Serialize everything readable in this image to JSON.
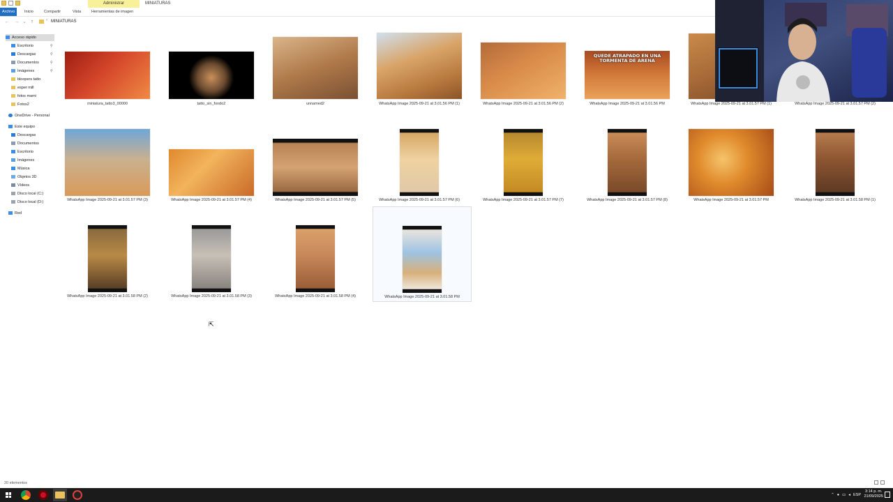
{
  "window": {
    "context_tab": "Administrar",
    "title": "MINIATURAS"
  },
  "ribbon": {
    "tabs": [
      {
        "label": "Archivo"
      },
      {
        "label": "Inicio"
      },
      {
        "label": "Compartir"
      },
      {
        "label": "Vista"
      },
      {
        "label": "Herramientas de imagen"
      }
    ]
  },
  "address": {
    "breadcrumb": "MINIATURAS"
  },
  "sidebar": {
    "items": [
      {
        "label": "Acceso rápido",
        "icon": "star-icon"
      },
      {
        "label": "Escritorio",
        "icon": "desktop-icon"
      },
      {
        "label": "Descargas",
        "icon": "download-icon"
      },
      {
        "label": "Documentos",
        "icon": "document-icon"
      },
      {
        "label": "Imágenes",
        "icon": "image-icon"
      },
      {
        "label": "bloopers tatto",
        "icon": "folder-icon"
      },
      {
        "label": "esper mill",
        "icon": "folder-icon"
      },
      {
        "label": "fotos mami",
        "icon": "folder-icon"
      },
      {
        "label": "Fotos2",
        "icon": "folder-icon"
      },
      {
        "label": "OneDrive - Personal",
        "icon": "cloud-icon"
      },
      {
        "label": "Este equipo",
        "icon": "computer-icon"
      },
      {
        "label": "Descargas",
        "icon": "download-icon"
      },
      {
        "label": "Documentos",
        "icon": "document-icon"
      },
      {
        "label": "Escritorio",
        "icon": "desktop-icon"
      },
      {
        "label": "Imágenes",
        "icon": "image-icon"
      },
      {
        "label": "Música",
        "icon": "music-icon"
      },
      {
        "label": "Objetos 3D",
        "icon": "cube-icon"
      },
      {
        "label": "Vídeos",
        "icon": "video-icon"
      },
      {
        "label": "Disco local (C:)",
        "icon": "drive-icon"
      },
      {
        "label": "Disco local (D:)",
        "icon": "drive-icon"
      },
      {
        "label": "Red",
        "icon": "network-icon"
      }
    ]
  },
  "files": [
    {
      "name": "miniatura_tatto3_00000"
    },
    {
      "name": "tatto_sin_fondo2"
    },
    {
      "name": "unnamed2"
    },
    {
      "name": "WhatsApp Image 2025-09-21 at 3.01.56 PM (1)"
    },
    {
      "name": "WhatsApp Image 2025-09-21 at 3.01.56 PM (2)"
    },
    {
      "name": "WhatsApp Image 2025-09-21 at 3.01.56 PM",
      "overlay": "QUEDE ATRAPADO EN UNA TORMENTA DE ARENA"
    },
    {
      "name": "WhatsApp Image 2025-09-21 at 3.01.57 PM (1)"
    },
    {
      "name": "WhatsApp Image 2025-09-21 at 3.01.57 PM (2)"
    },
    {
      "name": "WhatsApp Image 2025-09-21 at 3.01.57 PM (3)"
    },
    {
      "name": "WhatsApp Image 2025-09-21 at 3.01.57 PM (4)"
    },
    {
      "name": "WhatsApp Image 2025-09-21 at 3.01.57 PM (5)"
    },
    {
      "name": "WhatsApp Image 2025-09-21 at 3.01.57 PM (6)"
    },
    {
      "name": "WhatsApp Image 2025-09-21 at 3.01.57 PM (7)"
    },
    {
      "name": "WhatsApp Image 2025-09-21 at 3.01.57 PM (8)"
    },
    {
      "name": "WhatsApp Image 2025-09-21 at 3.01.57 PM"
    },
    {
      "name": "WhatsApp Image 2025-09-21 at 3.01.58 PM (1)"
    },
    {
      "name": "WhatsApp Image 2025-09-21 at 3.01.58 PM (2)"
    },
    {
      "name": "WhatsApp Image 2025-09-21 at 3.01.58 PM (3)"
    },
    {
      "name": "WhatsApp Image 2025-09-21 at 3.01.58 PM (4)"
    },
    {
      "name": "WhatsApp Image 2025-09-21 at 3.01.58 PM"
    }
  ],
  "status": {
    "count": "20 elementos"
  },
  "taskbar": {
    "lang": "ESP",
    "time": "3:14 p. m.",
    "date": "21/09/2025"
  },
  "colors": {
    "accent": "#1f6fc2",
    "context_tab": "#f9f19a",
    "taskbar": "#1b1b1b"
  }
}
